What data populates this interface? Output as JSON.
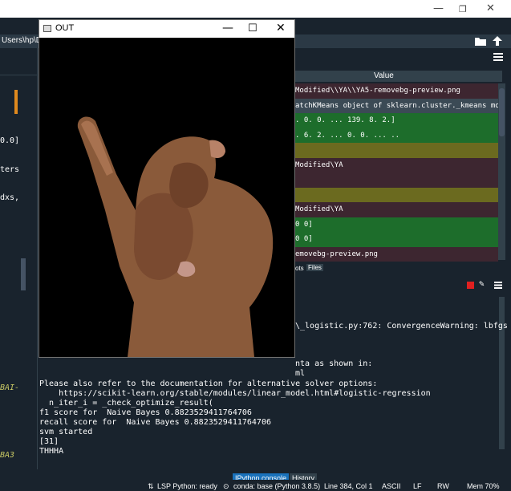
{
  "spyder": {
    "path_fragment": "Users\\hp\\Des",
    "left_fragments": [
      "0.0]",
      "ters",
      "dxs,",
      "BAI-",
      "BA3"
    ],
    "variable_explorer": {
      "value_header": "Value",
      "rows": [
        {
          "text": "Modified\\\\YA\\\\YA5-removebg-preview.png",
          "color": "#3d2630"
        },
        {
          "text": "atchKMeans object of sklearn.cluster._kmeans module",
          "color": "#3b4a55"
        },
        {
          "text": ".   0.   0. ... 139.   8.   2.]",
          "color": "#1d6d2b"
        },
        {
          "text": ".   6.   2. ...   0.   0. ... ..",
          "color": "#1d6d2b"
        },
        {
          "text": "",
          "color": "#6b6a1f"
        },
        {
          "text": "Modified\\YA",
          "color": "#3d2630"
        },
        {
          "text": "",
          "color": "#3d2630"
        },
        {
          "text": "",
          "color": "#6b6a1f"
        },
        {
          "text": "Modified\\YA",
          "color": "#3d2630"
        },
        {
          "text": "0 0]",
          "color": "#1d6d2b"
        },
        {
          "text": "0 0]",
          "color": "#1d6d2b"
        },
        {
          "text": "emovebg-preview.png",
          "color": "#3d2630"
        }
      ]
    },
    "pane_tabs": [
      "ots",
      "Files"
    ],
    "console": {
      "warning": "\\_logistic.py:762: ConvergenceWarning: lbfgs",
      "frag1": "nta as shown in:",
      "frag2": "ml",
      "lines": [
        "Please also refer to the documentation for alternative solver options:",
        "    https://scikit-learn.org/stable/modules/linear_model.html#logistic-regression",
        "  n_iter_i = _check_optimize_result(",
        "f1 score for  Naive Bayes 0.8823529411764706",
        "recall score for  Naive Bayes 0.8823529411764706",
        "svm started",
        "[31]",
        "THHHA"
      ]
    },
    "bottom_tabs": [
      "IPython console",
      "History"
    ],
    "status": {
      "lsp": "LSP Python: ready",
      "conda": "conda: base (Python 3.8.5)",
      "position": "Line 384, Col 1",
      "encoding": "ASCII",
      "eol": "LF",
      "rw": "RW",
      "mem": "Mem 70%"
    }
  },
  "out_window": {
    "title": "OUT",
    "icon": "window-app-icon",
    "controls": {
      "minimize": "—",
      "maximize": "☐",
      "close": "✕"
    }
  }
}
